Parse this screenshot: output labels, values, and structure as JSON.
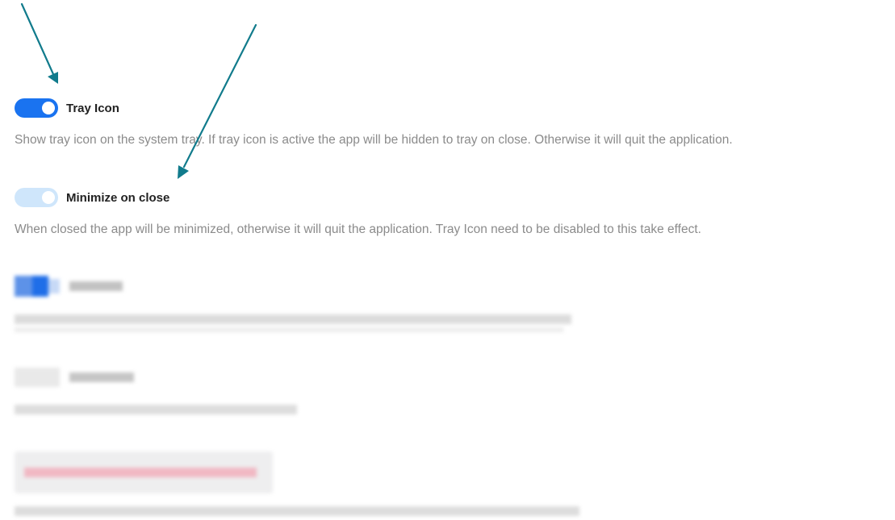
{
  "settings": [
    {
      "label": "Tray Icon",
      "description": "Show tray icon on the system tray. If tray icon is active the app will be hidden to tray on close. Otherwise it will quit the application.",
      "enabled": true
    },
    {
      "label": "Minimize on close",
      "description": "When closed the app will be minimized, otherwise it will quit the application. Tray Icon need to be disabled to this take effect.",
      "enabled": false
    }
  ],
  "colors": {
    "toggle_on": "#1a73f0",
    "toggle_off": "#cfe6fb",
    "label": "#222222",
    "description": "#8b8b8b",
    "arrow": "#117b8c"
  }
}
